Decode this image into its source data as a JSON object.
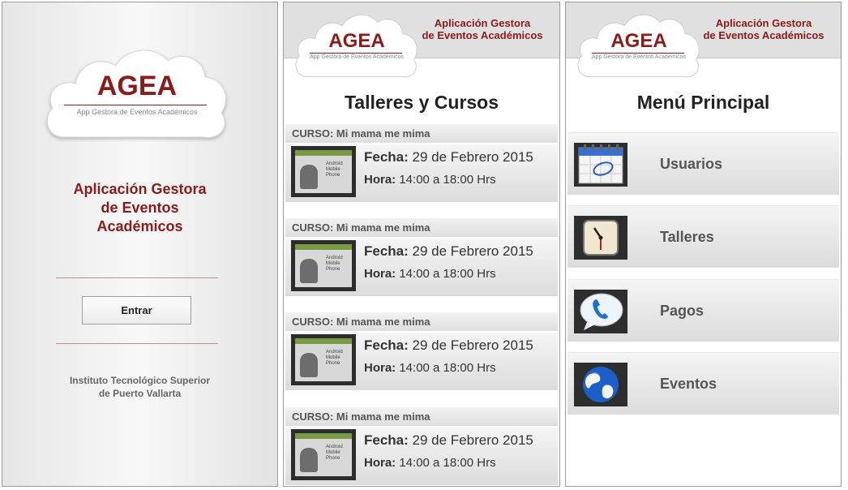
{
  "logo": {
    "title": "AGEA",
    "subtitle": "App Gestora de Eventos Académicos"
  },
  "header_title_line1": "Aplicación Gestora",
  "header_title_line2": "de Eventos Académicos",
  "login": {
    "app_name_line1": "Aplicación Gestora",
    "app_name_line2": "de Eventos",
    "app_name_line3": "Académicos",
    "enter_button": "Entrar",
    "institute_line1": "Instituto Tecnológico Superior",
    "institute_line2": "de Puerto Vallarta"
  },
  "courses_screen": {
    "title": "Talleres y Cursos",
    "thumb_text": [
      "Android",
      "Mobile",
      "Phone"
    ],
    "courses": [
      {
        "header": "CURSO: Mi mama me mima",
        "fecha_label": "Fecha:",
        "fecha": "29 de Febrero 2015",
        "hora_label": "Hora:",
        "hora": "14:00 a 18:00 Hrs"
      },
      {
        "header": "CURSO: Mi mama me mima",
        "fecha_label": "Fecha:",
        "fecha": "29 de Febrero 2015",
        "hora_label": "Hora:",
        "hora": "14:00 a 18:00 Hrs"
      },
      {
        "header": "CURSO: Mi mama me mima",
        "fecha_label": "Fecha:",
        "fecha": "29 de Febrero 2015",
        "hora_label": "Hora:",
        "hora": "14:00 a 18:00 Hrs"
      },
      {
        "header": "CURSO: Mi mama me mima",
        "fecha_label": "Fecha:",
        "fecha": "29 de Febrero 2015",
        "hora_label": "Hora:",
        "hora": "14:00 a 18:00 Hrs"
      }
    ]
  },
  "menu_screen": {
    "title": "Menú Principal",
    "items": [
      {
        "label": "Usuarios",
        "icon": "calendar-icon"
      },
      {
        "label": "Talleres",
        "icon": "clock-icon"
      },
      {
        "label": "Pagos",
        "icon": "phone-icon"
      },
      {
        "label": "Eventos",
        "icon": "globe-icon"
      }
    ]
  },
  "colors": {
    "brand": "#8b1a1a",
    "divider": "#c98b8b"
  }
}
